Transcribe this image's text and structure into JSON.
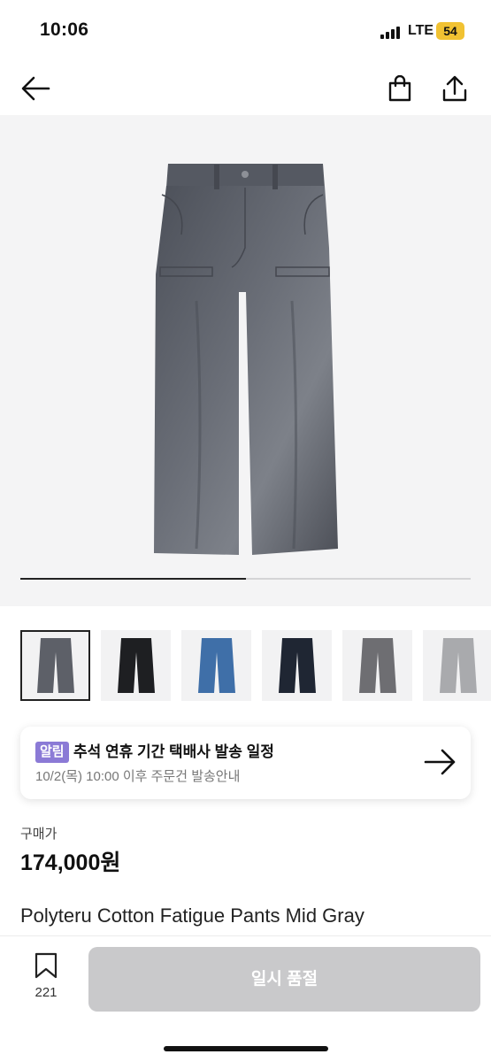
{
  "status_bar": {
    "time": "10:06",
    "network": "LTE",
    "battery": "54"
  },
  "nav": {
    "back_icon": "arrow-left-icon",
    "bag_icon": "shopping-bag-icon",
    "share_icon": "share-icon"
  },
  "gallery": {
    "image_icon": "pants-image",
    "progress": 0.5
  },
  "thumbnails": [
    {
      "color": "#5d6068",
      "selected": true
    },
    {
      "color": "#1e1f22"
    },
    {
      "color": "#3f6fa8"
    },
    {
      "color": "#1f2633"
    },
    {
      "color": "#6e6e72"
    },
    {
      "color": "#a9aaad"
    }
  ],
  "notice": {
    "badge": "알림",
    "title": "추석 연휴 기간 택배사 발송 일정",
    "subtitle": "10/2(목) 10:00 이후 주문건 발송안내",
    "arrow_icon": "arrow-right-icon"
  },
  "product": {
    "price_label": "구매가",
    "price": "174,000원",
    "name": "Polyteru Cotton Fatigue Pants Mid Gray"
  },
  "bottom_bar": {
    "wishlist_icon": "bookmark-icon",
    "wishlist_count": "221",
    "soldout_label": "일시 품절"
  }
}
